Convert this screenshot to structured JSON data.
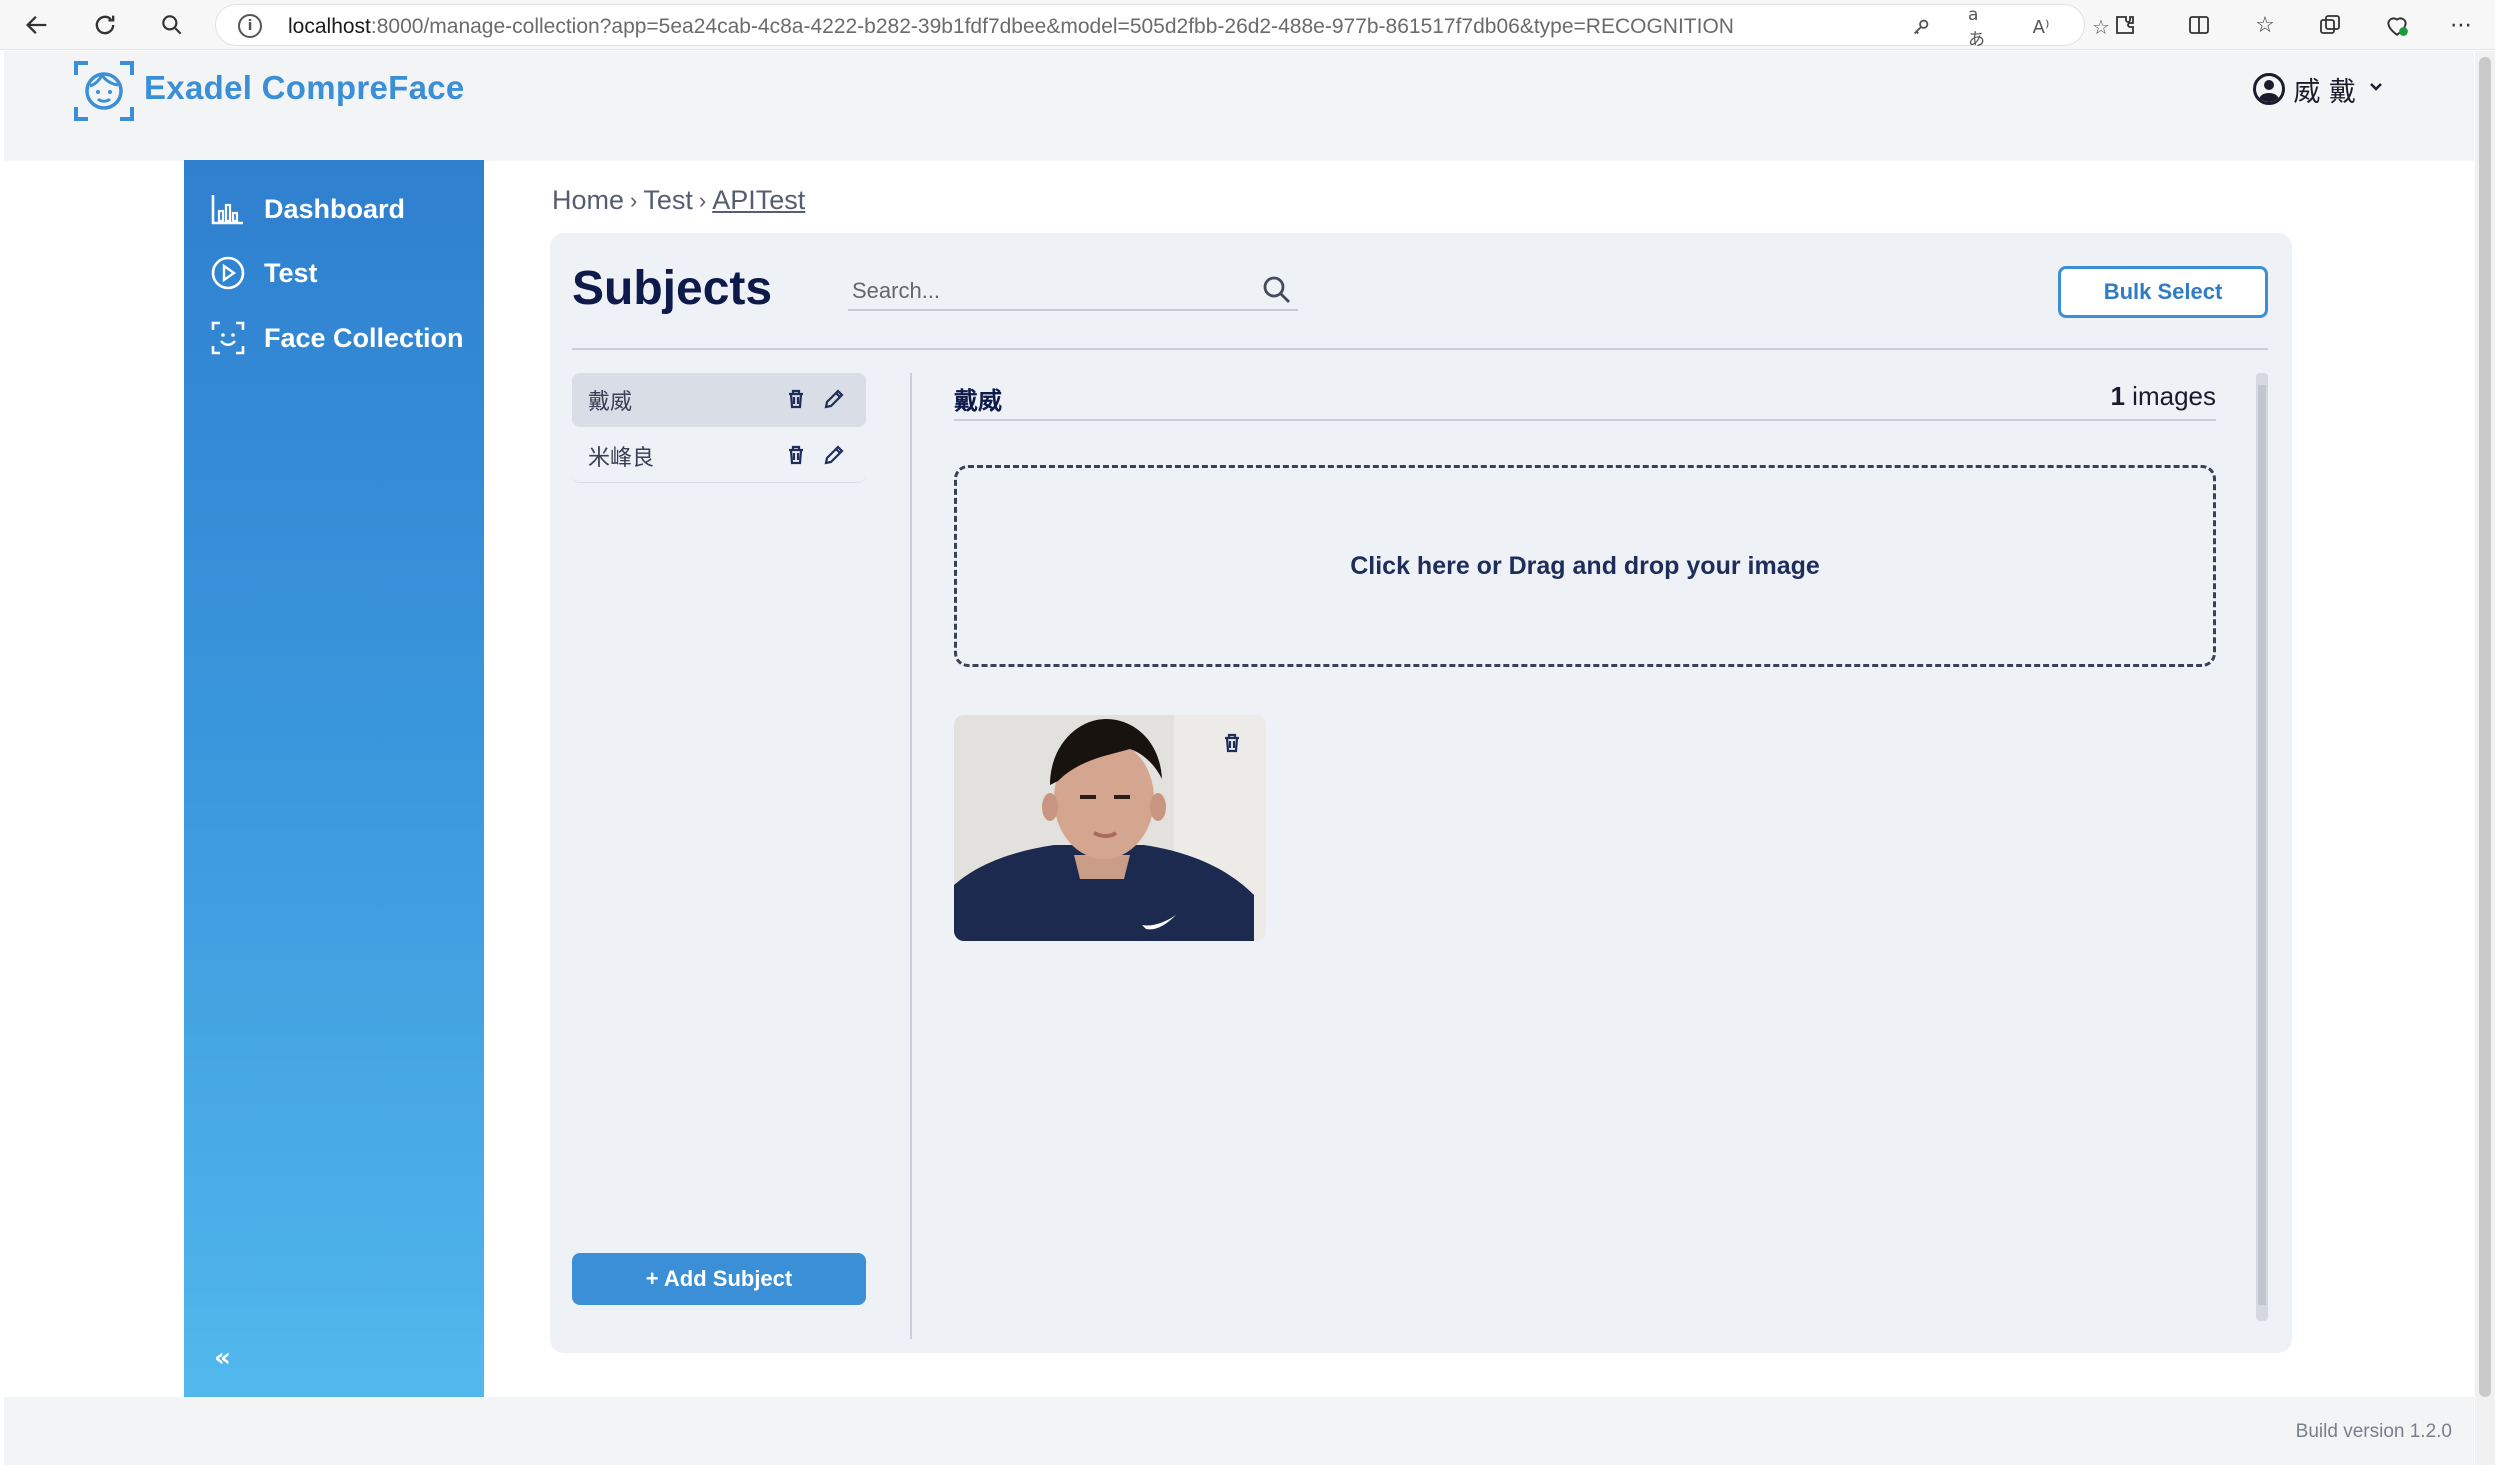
{
  "browser": {
    "url_host": "localhost",
    "url_rest": ":8000/manage-collection?app=5ea24cab-4c8a-4222-b282-39b1fdf7dbee&model=505d2fbb-26d2-488e-977b-861517f7db06&type=RECOGNITION"
  },
  "app": {
    "logo_text": "Exadel CompreFace",
    "user_name": "威 戴",
    "build_version": "Build version 1.2.0",
    "brand_color": "#3b8fd7"
  },
  "sidebar": {
    "items": [
      {
        "label": "Dashboard",
        "icon": "bar-chart-icon"
      },
      {
        "label": "Test",
        "icon": "play-circle-icon"
      },
      {
        "label": "Face Collection",
        "icon": "face-scan-icon"
      }
    ],
    "collapse_label": "«"
  },
  "breadcrumb": {
    "home": "Home",
    "sep": "›",
    "app": "Test",
    "model": "APITest"
  },
  "subjects": {
    "title": "Subjects",
    "search_placeholder": "Search...",
    "bulk_select_label": "Bulk Select",
    "add_subject_label": "+ Add Subject",
    "list": [
      {
        "name": "戴威",
        "active": true
      },
      {
        "name": "米峰良",
        "active": false
      }
    ]
  },
  "detail": {
    "subject_name": "戴威",
    "image_count": "1",
    "image_count_suffix": " images",
    "dropzone_text": "Click here or Drag and drop your image"
  }
}
